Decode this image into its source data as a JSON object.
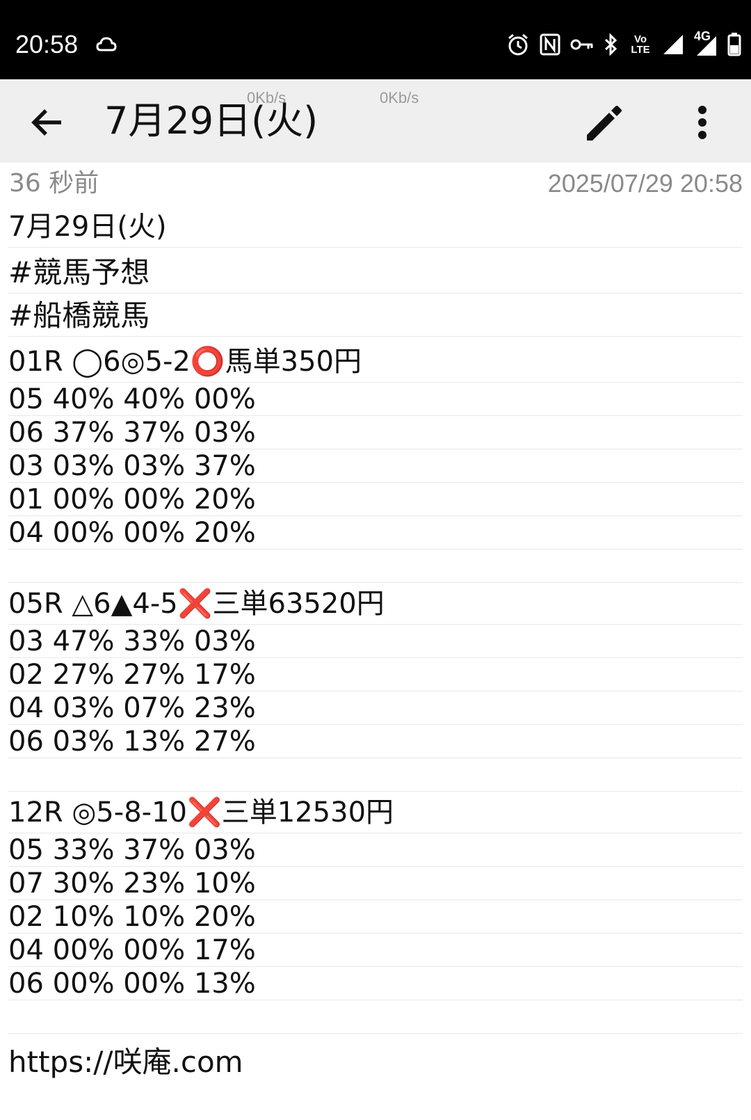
{
  "status_bar": {
    "time": "20:58",
    "icons": [
      "cloud-icon",
      "alarm-icon",
      "nfc-icon",
      "vpn-key-icon",
      "bluetooth-icon",
      "volte-icon",
      "signal-icon",
      "4g-signal-icon",
      "battery-icon"
    ],
    "volte_label": "Vo LTE",
    "network_label": "4G"
  },
  "app_bar": {
    "title": "7月29日(火)",
    "net_speed_1": "0Kb/s",
    "net_speed_2": "0Kb/s"
  },
  "meta": {
    "relative_time": "36 秒前",
    "timestamp": "2025/07/29 20:58"
  },
  "note": {
    "lines": [
      "7月29日(火)",
      "#競馬予想",
      "#船橋競馬",
      "01R ◯6◎5-2⭕馬単350円",
      "05 40% 40% 00%",
      "06 37% 37% 03%",
      "03 03% 03% 37%",
      "01 00% 00% 20%",
      "04 00% 00% 20%",
      "",
      "05R △6▲4-5❌三単63520円",
      "03 47% 33% 03%",
      "02 27% 27% 17%",
      "04 03% 07% 23%",
      "06 03% 13% 27%",
      "",
      "12R ◎5-8-10❌三単12530円",
      "05 33% 37% 03%",
      "07 30% 23% 10%",
      "02 10% 10% 20%",
      "04 00% 00% 17%",
      "06 00% 00% 13%",
      "",
      "https://咲庵.com"
    ]
  }
}
